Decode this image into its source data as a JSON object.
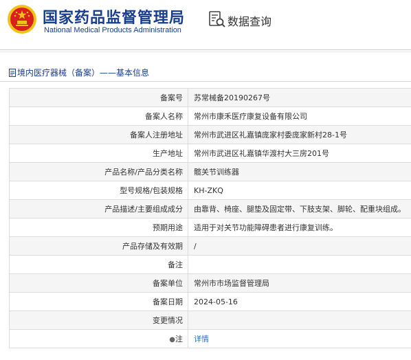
{
  "header": {
    "org_name_cn": "国家药品监督管理局",
    "org_name_en": "National Medical Products Administration",
    "query_label": "数据查询"
  },
  "section": {
    "title": "境内医疗器械（备案）——基本信息"
  },
  "rows": [
    {
      "label": "备案号",
      "value": "苏常械备20190267号"
    },
    {
      "label": "备案人名称",
      "value": "常州市康禾医疗康复设备有限公司"
    },
    {
      "label": "备案人注册地址",
      "value": "常州市武进区礼嘉镇庞家村委庞家新村28-1号"
    },
    {
      "label": "生产地址",
      "value": "常州市武进区礼嘉镇华渡村大三房201号"
    },
    {
      "label": "产品名称/产品分类名称",
      "value": "髋关节训练器"
    },
    {
      "label": "型号规格/包装规格",
      "value": "KH-ZKQ"
    },
    {
      "label": "产品描述/主要组成成分",
      "value": "由靠背、椅座、腿垫及固定带、下肢支架、脚轮、配重块组成。"
    },
    {
      "label": "预期用途",
      "value": "适用于对关节功能障碍患者进行康复训练。"
    },
    {
      "label": "产品存储及有效期",
      "value": "/"
    },
    {
      "label": "备注",
      "value": ""
    },
    {
      "label": "备案单位",
      "value": "常州市市场监督管理局"
    },
    {
      "label": "备案日期",
      "value": "2024-05-16"
    },
    {
      "label": "变更情况",
      "value": ""
    }
  ],
  "note": {
    "label": "注",
    "link_text": "详情",
    "icon": "pin-icon"
  },
  "colors": {
    "brand_blue": "#1a3d8f",
    "link_blue": "#2a6fcf",
    "emblem_red": "#d8201c",
    "emblem_gold": "#f2c21a"
  }
}
